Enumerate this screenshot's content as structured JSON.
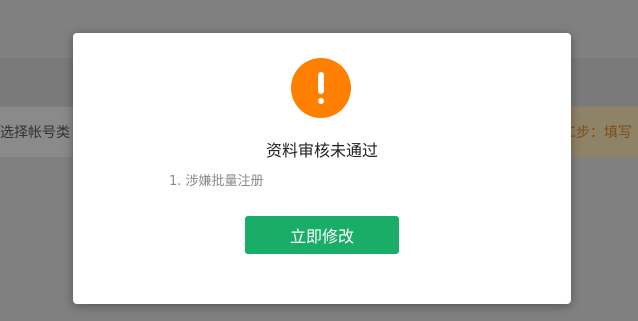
{
  "background": {
    "step_left_text": "选择帐号类",
    "step_right_text": "二步：填写"
  },
  "dialog": {
    "icon": "exclamation-icon",
    "icon_color": "#ff7f00",
    "title": "资料审核未通过",
    "reasons": [
      "1. 涉嫌批量注册"
    ],
    "primary_button_label": "立即修改",
    "primary_button_color": "#1aad68"
  }
}
